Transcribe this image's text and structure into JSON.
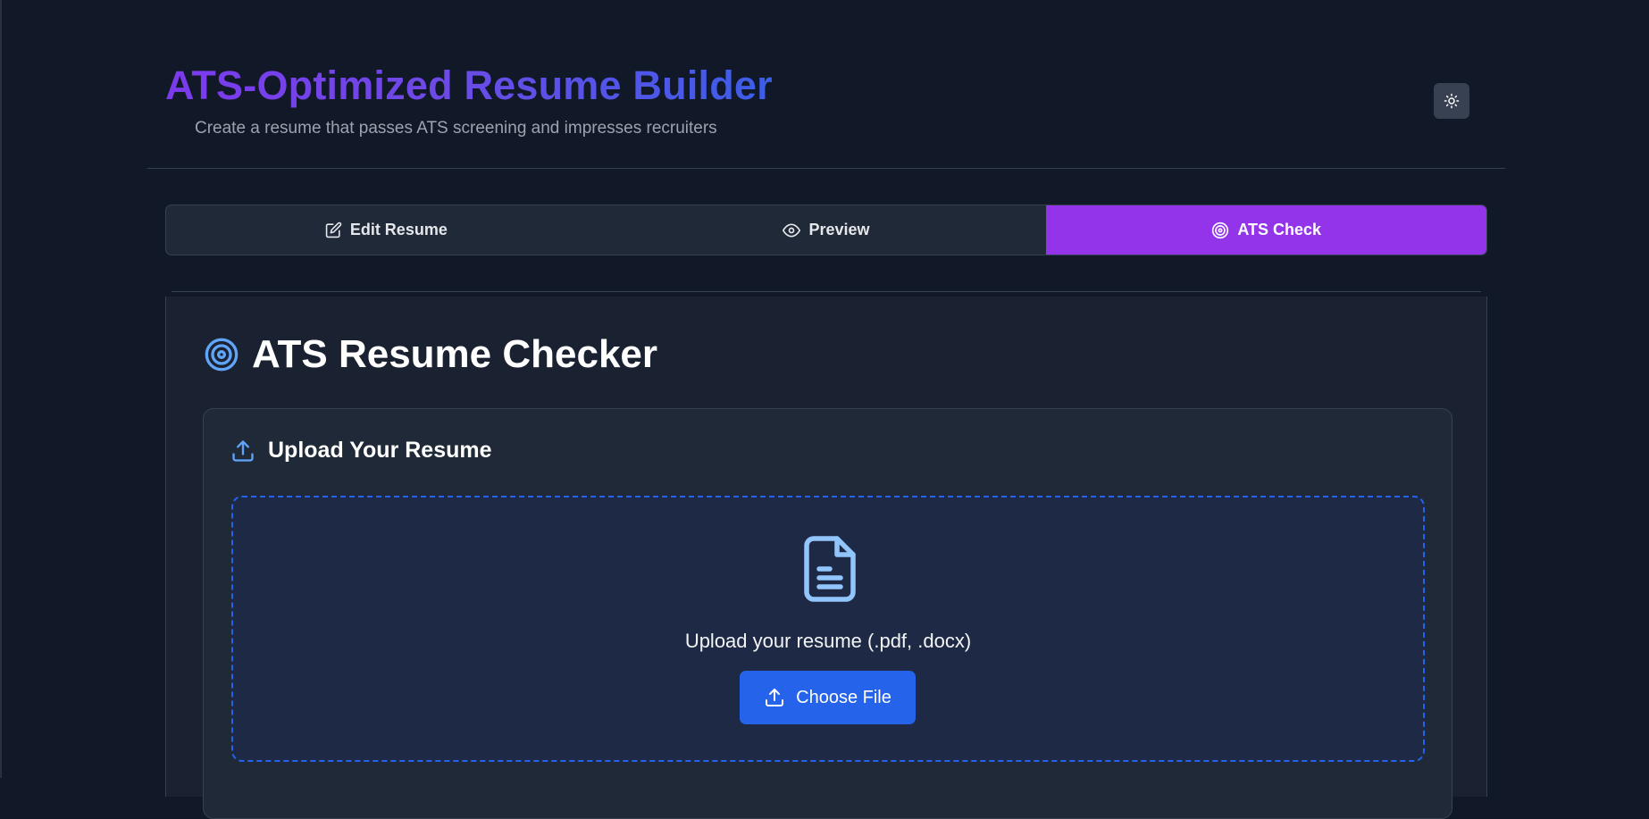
{
  "header": {
    "title": "ATS-Optimized Resume Builder",
    "subtitle": "Create a resume that passes ATS screening and impresses recruiters",
    "theme_toggle_icon": "sun-icon"
  },
  "tabs": [
    {
      "label": "Edit Resume",
      "icon": "edit-icon",
      "active": false
    },
    {
      "label": "Preview",
      "icon": "eye-icon",
      "active": false
    },
    {
      "label": "ATS Check",
      "icon": "target-icon",
      "active": true
    }
  ],
  "checker": {
    "title": "ATS Resume Checker",
    "icon": "target-icon"
  },
  "upload": {
    "title": "Upload Your Resume",
    "icon": "upload-icon",
    "dropzone_icon": "document-icon",
    "dropzone_text": "Upload your resume (.pdf, .docx)",
    "button_label": "Choose File"
  },
  "colors": {
    "background": "#111827",
    "accent_purple": "#9333ea",
    "accent_blue": "#2563eb",
    "icon_blue": "#60a5fa"
  }
}
